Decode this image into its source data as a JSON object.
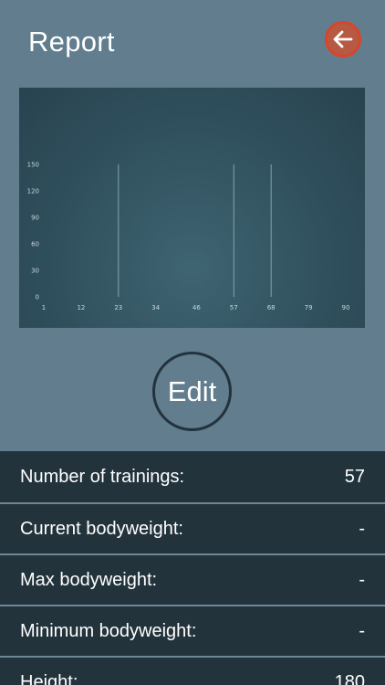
{
  "header": {
    "title": "Report",
    "back_icon": "arrow-left-icon",
    "back_color": "#b75a43"
  },
  "chart_data": {
    "type": "bar",
    "title": "",
    "xlabel": "",
    "ylabel": "",
    "x_ticks": [
      "1",
      "12",
      "23",
      "34",
      "46",
      "57",
      "68",
      "79",
      "90"
    ],
    "y_ticks": [
      "0",
      "30",
      "60",
      "90",
      "120",
      "150"
    ],
    "ylim": [
      0,
      150
    ],
    "xlim": [
      1,
      90
    ],
    "x": [
      23,
      57,
      68
    ],
    "values": [
      150,
      150,
      150
    ],
    "grid": false
  },
  "edit_button": {
    "label": "Edit"
  },
  "stats": [
    {
      "label": "Number of trainings:",
      "value": "57"
    },
    {
      "label": "Current bodyweight:",
      "value": "-"
    },
    {
      "label": "Max bodyweight:",
      "value": "-"
    },
    {
      "label": "Minimum bodyweight:",
      "value": "-"
    },
    {
      "label": "Height:",
      "value": "180"
    }
  ]
}
